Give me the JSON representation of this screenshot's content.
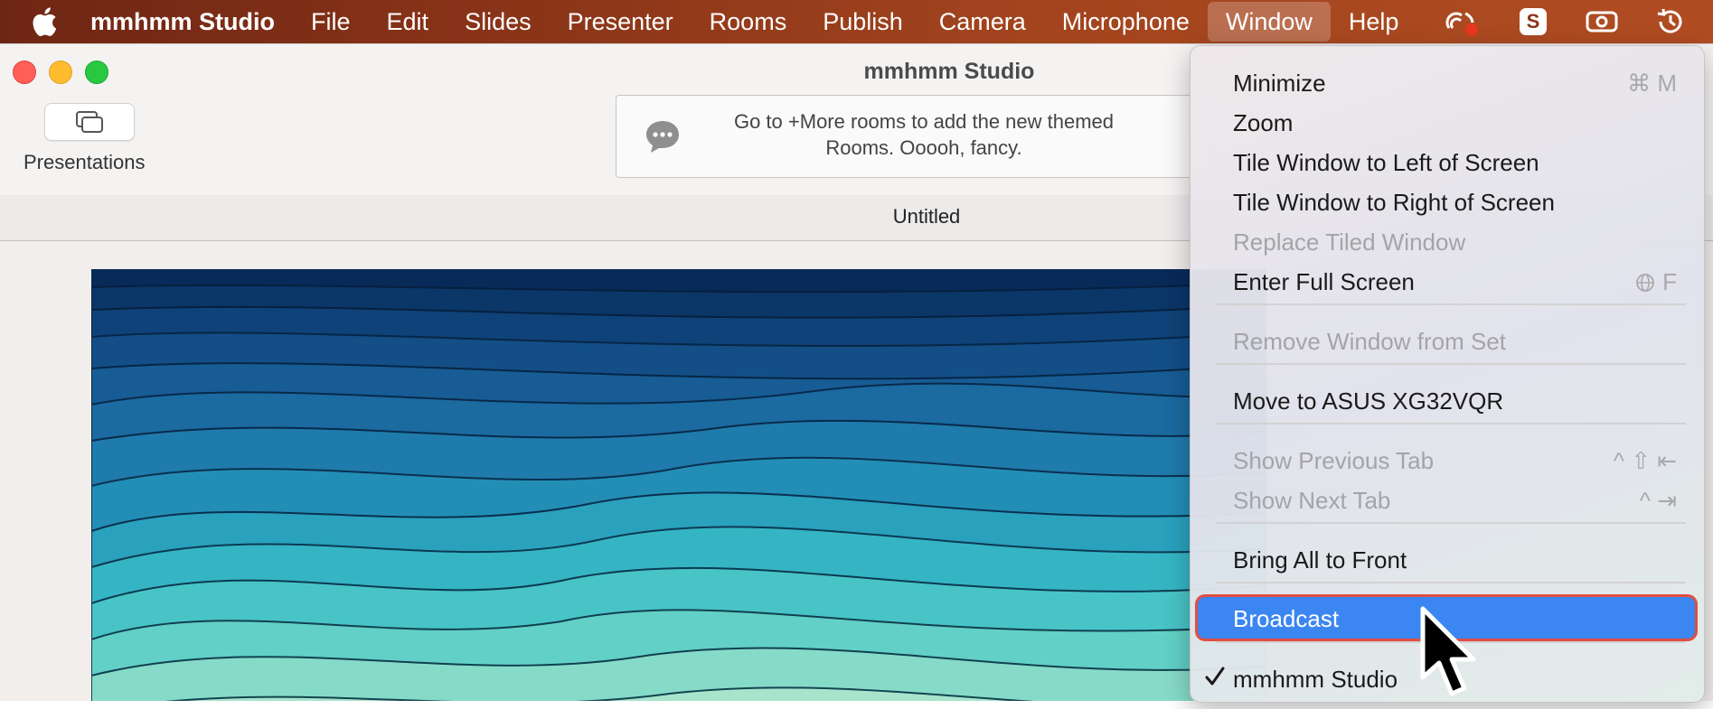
{
  "menubar": {
    "apple_icon": "apple-logo",
    "app_name": "mmhmm Studio",
    "items": [
      "File",
      "Edit",
      "Slides",
      "Presenter",
      "Rooms",
      "Publish",
      "Camera",
      "Microphone",
      "Window",
      "Help"
    ],
    "active_item": "Window",
    "tray": {
      "status_icon": "cloud-record-icon",
      "s_app_letter": "S",
      "camera_icon": "camera-box-icon",
      "history_icon": "time-machine-icon"
    }
  },
  "window": {
    "title": "mmhmm Studio",
    "toolbar": {
      "presentations_label": "Presentations"
    },
    "notice": {
      "text_line1": "Go to +More rooms to add the new themed",
      "text_line2": "Rooms. Ooooh, fancy."
    },
    "tab_title": "Untitled"
  },
  "window_menu": {
    "items": [
      {
        "label": "Minimize",
        "shortcut": "⌘ M",
        "enabled": true
      },
      {
        "label": "Zoom",
        "shortcut": "",
        "enabled": true
      },
      {
        "label": "Tile Window to Left of Screen",
        "shortcut": "",
        "enabled": true
      },
      {
        "label": "Tile Window to Right of Screen",
        "shortcut": "",
        "enabled": true
      },
      {
        "label": "Replace Tiled Window",
        "shortcut": "",
        "enabled": false
      },
      {
        "label": "Enter Full Screen",
        "shortcut": "F",
        "enabled": true
      },
      {
        "label": "Remove Window from Set",
        "shortcut": "",
        "enabled": false
      },
      {
        "label": "Move to ASUS XG32VQR",
        "shortcut": "",
        "enabled": true
      },
      {
        "label": "Show Previous Tab",
        "shortcut": "^ ⇧ ⇤",
        "enabled": false
      },
      {
        "label": "Show Next Tab",
        "shortcut": "^ ⇥",
        "enabled": false
      },
      {
        "label": "Bring All to Front",
        "shortcut": "",
        "enabled": true
      },
      {
        "label": "Broadcast",
        "shortcut": "",
        "enabled": true,
        "highlighted": true
      },
      {
        "label": "mmhmm Studio",
        "shortcut": "",
        "enabled": true,
        "checked": true
      }
    ]
  },
  "colors": {
    "menubar_start": "#6e2614",
    "menubar_end": "#b04c22",
    "highlight_blue": "#3b86f0",
    "highlight_outline": "#e04e42",
    "close": "#ff5f57",
    "minimize": "#febc2e",
    "zoom": "#28c840"
  }
}
